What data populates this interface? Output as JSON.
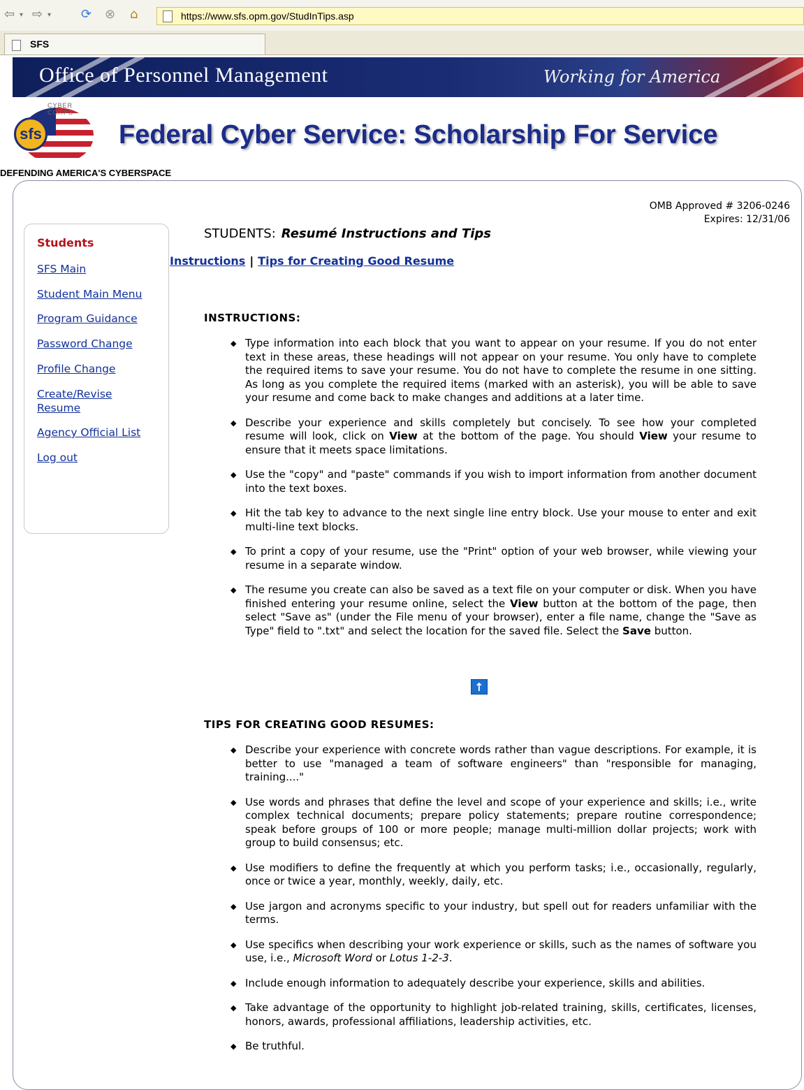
{
  "browser": {
    "url": "https://www.sfs.opm.gov/StudInTips.asp",
    "tab_title": "SFS"
  },
  "banner": {
    "title": "Office of Personnel Management",
    "script": "Working for America"
  },
  "header": {
    "logo_text": "sfs",
    "logo_arc": "CYBER CORPS",
    "site_title": "Federal Cyber Service: Scholarship For Service",
    "tagline": "DEFENDING AMERICA'S CYBERSPACE"
  },
  "omb": {
    "line1": "OMB Approved # 3206-0246",
    "line2": "Expires: 12/31/06"
  },
  "sidebar": {
    "heading": "Students",
    "items": [
      {
        "label": "SFS Main"
      },
      {
        "label": "Student Main Menu"
      },
      {
        "label": "Program Guidance"
      },
      {
        "label": "Password Change"
      },
      {
        "label": "Profile Change"
      },
      {
        "label": "Create/Revise Resume"
      },
      {
        "label": "Agency Official List"
      },
      {
        "label": "Log out"
      }
    ]
  },
  "main": {
    "heading": "STUDENTS:",
    "heading_sub": "Resumé Instructions and Tips",
    "anchor_instructions": "Instructions",
    "anchor_sep": "|",
    "anchor_tips": "Tips for Creating Good Resume",
    "up_arrow": "↑",
    "instructions": {
      "title": "INSTRUCTIONS:",
      "items": [
        "Type information into each block that you want to appear on your resume. If you do not enter text in these areas, these headings will not appear on your resume. You only have to complete the required items to save your resume. You do not have to complete the resume in one sitting. As long as you complete the required items (marked with an asterisk), you will be able to save your resume and come back to make changes and additions at a later time.",
        "Describe your experience and skills completely but concisely. To see how your completed resume will look, click on View at the bottom of the page. You should View your resume to ensure that it meets space limitations.",
        "Use the \"copy\" and \"paste\" commands if you wish to import information from another document into the text boxes.",
        "Hit the tab key to advance to the next single line entry block. Use your mouse to enter and exit multi-line text blocks.",
        "To print a copy of your resume, use the \"Print\" option of your web browser, while viewing your resume in a separate window.",
        "The resume you create can also be saved as a text file on your computer or disk. When you have finished entering your resume online, select the View button at the bottom of the page, then select \"Save as\" (under the File menu of your browser), enter a file name, change the \"Save as Type\" field to \".txt\" and select the location for the saved file. Select the Save button."
      ]
    },
    "tips": {
      "title": "TIPS FOR CREATING GOOD RESUMES:",
      "items": [
        "Describe your experience with concrete words rather than vague descriptions. For example, it is better to use \"managed a team of software engineers\" than \"responsible for managing, training....\"",
        "Use words and phrases that define the level and scope of your experience and skills; i.e., write complex technical documents; prepare policy statements; prepare routine correspondence; speak before groups of 100 or more people; manage multi-million dollar projects; work with group to build consensus; etc.",
        "Use modifiers to define the frequently at which you perform tasks; i.e., occasionally, regularly, once or twice a year, monthly, weekly, daily, etc.",
        "Use jargon and acronyms specific to your industry, but spell out for readers unfamiliar with the terms.",
        "Use specifics when describing your work experience or skills, such as the names of software you use, i.e., Microsoft Word or Lotus 1-2-3.",
        "Include enough information to adequately describe your experience, skills and abilities.",
        "Take advantage of the opportunity to highlight job-related training, skills, certificates, licenses, honors, awards, professional affiliations, leadership activities, etc.",
        "Be truthful."
      ]
    }
  }
}
